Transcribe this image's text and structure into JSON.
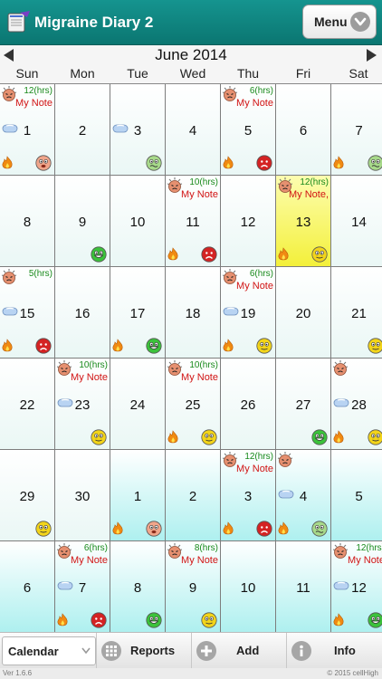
{
  "app": {
    "title": "Migraine Diary 2",
    "menu_label": "Menu"
  },
  "calendar": {
    "month_title": "June 2014",
    "weekdays": [
      "Sun",
      "Mon",
      "Tue",
      "Wed",
      "Thu",
      "Fri",
      "Sat"
    ],
    "days": [
      {
        "day": "1",
        "in_month": true,
        "headache": true,
        "hours": "12(hrs)",
        "note": "My Note",
        "med": true,
        "trigger": true,
        "mood": "pained"
      },
      {
        "day": "2",
        "in_month": true
      },
      {
        "day": "3",
        "in_month": true,
        "med": true,
        "mood": "sick"
      },
      {
        "day": "4",
        "in_month": true
      },
      {
        "day": "5",
        "in_month": true,
        "headache": true,
        "hours": "6(hrs)",
        "note": "My Note",
        "trigger": true,
        "mood": "angry"
      },
      {
        "day": "6",
        "in_month": true
      },
      {
        "day": "7",
        "in_month": true,
        "trigger": true,
        "mood": "sick"
      },
      {
        "day": "8",
        "in_month": true
      },
      {
        "day": "9",
        "in_month": true,
        "mood": "happy"
      },
      {
        "day": "10",
        "in_month": true
      },
      {
        "day": "11",
        "in_month": true,
        "headache": true,
        "hours": "10(hrs)",
        "note": "My Note",
        "trigger": true,
        "mood": "angry"
      },
      {
        "day": "12",
        "in_month": true
      },
      {
        "day": "13",
        "in_month": true,
        "today": true,
        "headache": true,
        "hours": "12(hrs)",
        "note": "My Note,",
        "trigger": true,
        "mood": "ok"
      },
      {
        "day": "14",
        "in_month": true
      },
      {
        "day": "15",
        "in_month": true,
        "headache": true,
        "hours": "5(hrs)",
        "med": true,
        "trigger": true,
        "mood": "angry"
      },
      {
        "day": "16",
        "in_month": true
      },
      {
        "day": "17",
        "in_month": true,
        "trigger": true,
        "mood": "happy"
      },
      {
        "day": "18",
        "in_month": true
      },
      {
        "day": "19",
        "in_month": true,
        "headache": true,
        "hours": "6(hrs)",
        "note": "My Note",
        "med": true,
        "trigger": true,
        "mood": "ok"
      },
      {
        "day": "20",
        "in_month": true
      },
      {
        "day": "21",
        "in_month": true,
        "mood": "ok"
      },
      {
        "day": "22",
        "in_month": true
      },
      {
        "day": "23",
        "in_month": true,
        "headache": true,
        "hours": "10(hrs)",
        "note": "My Note",
        "med": true,
        "mood": "ok"
      },
      {
        "day": "24",
        "in_month": true
      },
      {
        "day": "25",
        "in_month": true,
        "headache": true,
        "hours": "10(hrs)",
        "note": "My Note",
        "trigger": true,
        "mood": "ok"
      },
      {
        "day": "26",
        "in_month": true
      },
      {
        "day": "27",
        "in_month": true,
        "mood": "happy"
      },
      {
        "day": "28",
        "in_month": true,
        "headache": true,
        "med": true,
        "trigger": true,
        "mood": "ok"
      },
      {
        "day": "29",
        "in_month": true,
        "mood": "ok"
      },
      {
        "day": "30",
        "in_month": true
      },
      {
        "day": "1",
        "in_month": false,
        "trigger": true,
        "mood": "pained"
      },
      {
        "day": "2",
        "in_month": false
      },
      {
        "day": "3",
        "in_month": false,
        "headache": true,
        "hours": "12(hrs)",
        "note": "My Note",
        "trigger": true,
        "mood": "angry"
      },
      {
        "day": "4",
        "in_month": false,
        "headache": true,
        "med": true,
        "trigger": true,
        "mood": "sick"
      },
      {
        "day": "5",
        "in_month": false
      },
      {
        "day": "6",
        "in_month": false
      },
      {
        "day": "7",
        "in_month": false,
        "headache": true,
        "hours": "6(hrs)",
        "note": "My Note",
        "med": true,
        "trigger": true,
        "mood": "angry"
      },
      {
        "day": "8",
        "in_month": false,
        "mood": "happy"
      },
      {
        "day": "9",
        "in_month": false,
        "headache": true,
        "hours": "8(hrs)",
        "note": "My Note",
        "mood": "ok"
      },
      {
        "day": "10",
        "in_month": false
      },
      {
        "day": "11",
        "in_month": false
      },
      {
        "day": "12",
        "in_month": false,
        "headache": true,
        "hours": "12(hrs)",
        "note": "My Note",
        "med": true,
        "trigger": true,
        "mood": "happy"
      }
    ]
  },
  "toolbar": {
    "calendar_label": "Calendar",
    "reports_label": "Reports",
    "add_label": "Add",
    "info_label": "Info"
  },
  "footer": {
    "version": "Ver 1.6.6",
    "copyright": "© 2015 cellHigh"
  },
  "colors": {
    "header": "#0b7671",
    "hours_text": "#17891a",
    "note_text": "#d11313",
    "today_fill": "#f3f03a",
    "other_month_fill": "#aef0ef"
  },
  "icons": {
    "headache": "headache-face-icon",
    "medication": "pill-icon",
    "trigger": "flame-icon",
    "mood_happy": "happy-face-icon",
    "mood_ok": "neutral-face-icon",
    "mood_angry": "angry-face-icon",
    "mood_sick": "sick-face-icon",
    "mood_pained": "pained-face-icon"
  }
}
